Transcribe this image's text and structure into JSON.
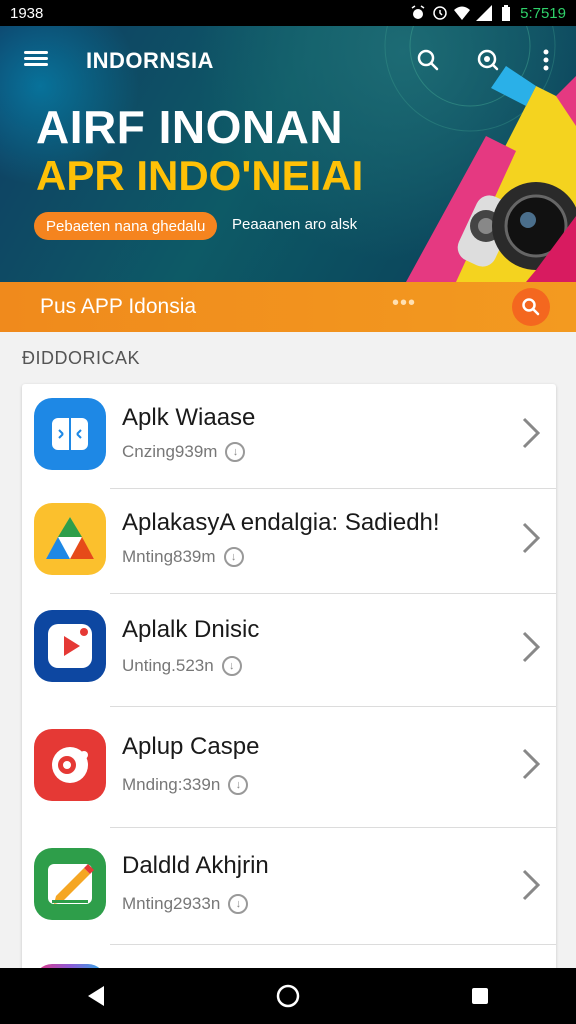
{
  "status_bar": {
    "time_left": "1938",
    "time_right": "5:7519"
  },
  "header": {
    "brand": "INDORNSIA"
  },
  "hero": {
    "title": "AIRF INONAN",
    "subtitle": "APR INDO'NEIAI",
    "pill_label": "Pebaeten nana ghedalu",
    "description": "Peaaanen aro alsk"
  },
  "search": {
    "label": "Pus APP Idonsia",
    "dots": "•••"
  },
  "section": {
    "title": "ÐIDDORICAK"
  },
  "apps": [
    {
      "name": "Aplk Wiaase",
      "meta": "Cnzing939m",
      "icon": "split-screen-icon",
      "color": "#1e88e5"
    },
    {
      "name": "AplakasyA endalgia: Sadiedh!",
      "meta": "Mnting839m",
      "icon": "drive-triangle-icon",
      "color": "#fbc02d"
    },
    {
      "name": "Aplalk Dnisic",
      "meta": "Unting.523n",
      "icon": "play-icon",
      "color": "#0d47a1"
    },
    {
      "name": "Aplup Caspe",
      "meta": "Mnding:339n",
      "icon": "camera-icon",
      "color": "#e53935"
    },
    {
      "name": "Daldld Akhjrin",
      "meta": "Mnting2933n",
      "icon": "edit-icon",
      "color": "#2e9e4a"
    }
  ],
  "nav": {
    "back": "back-icon",
    "home": "home-icon",
    "recents": "recents-icon"
  }
}
